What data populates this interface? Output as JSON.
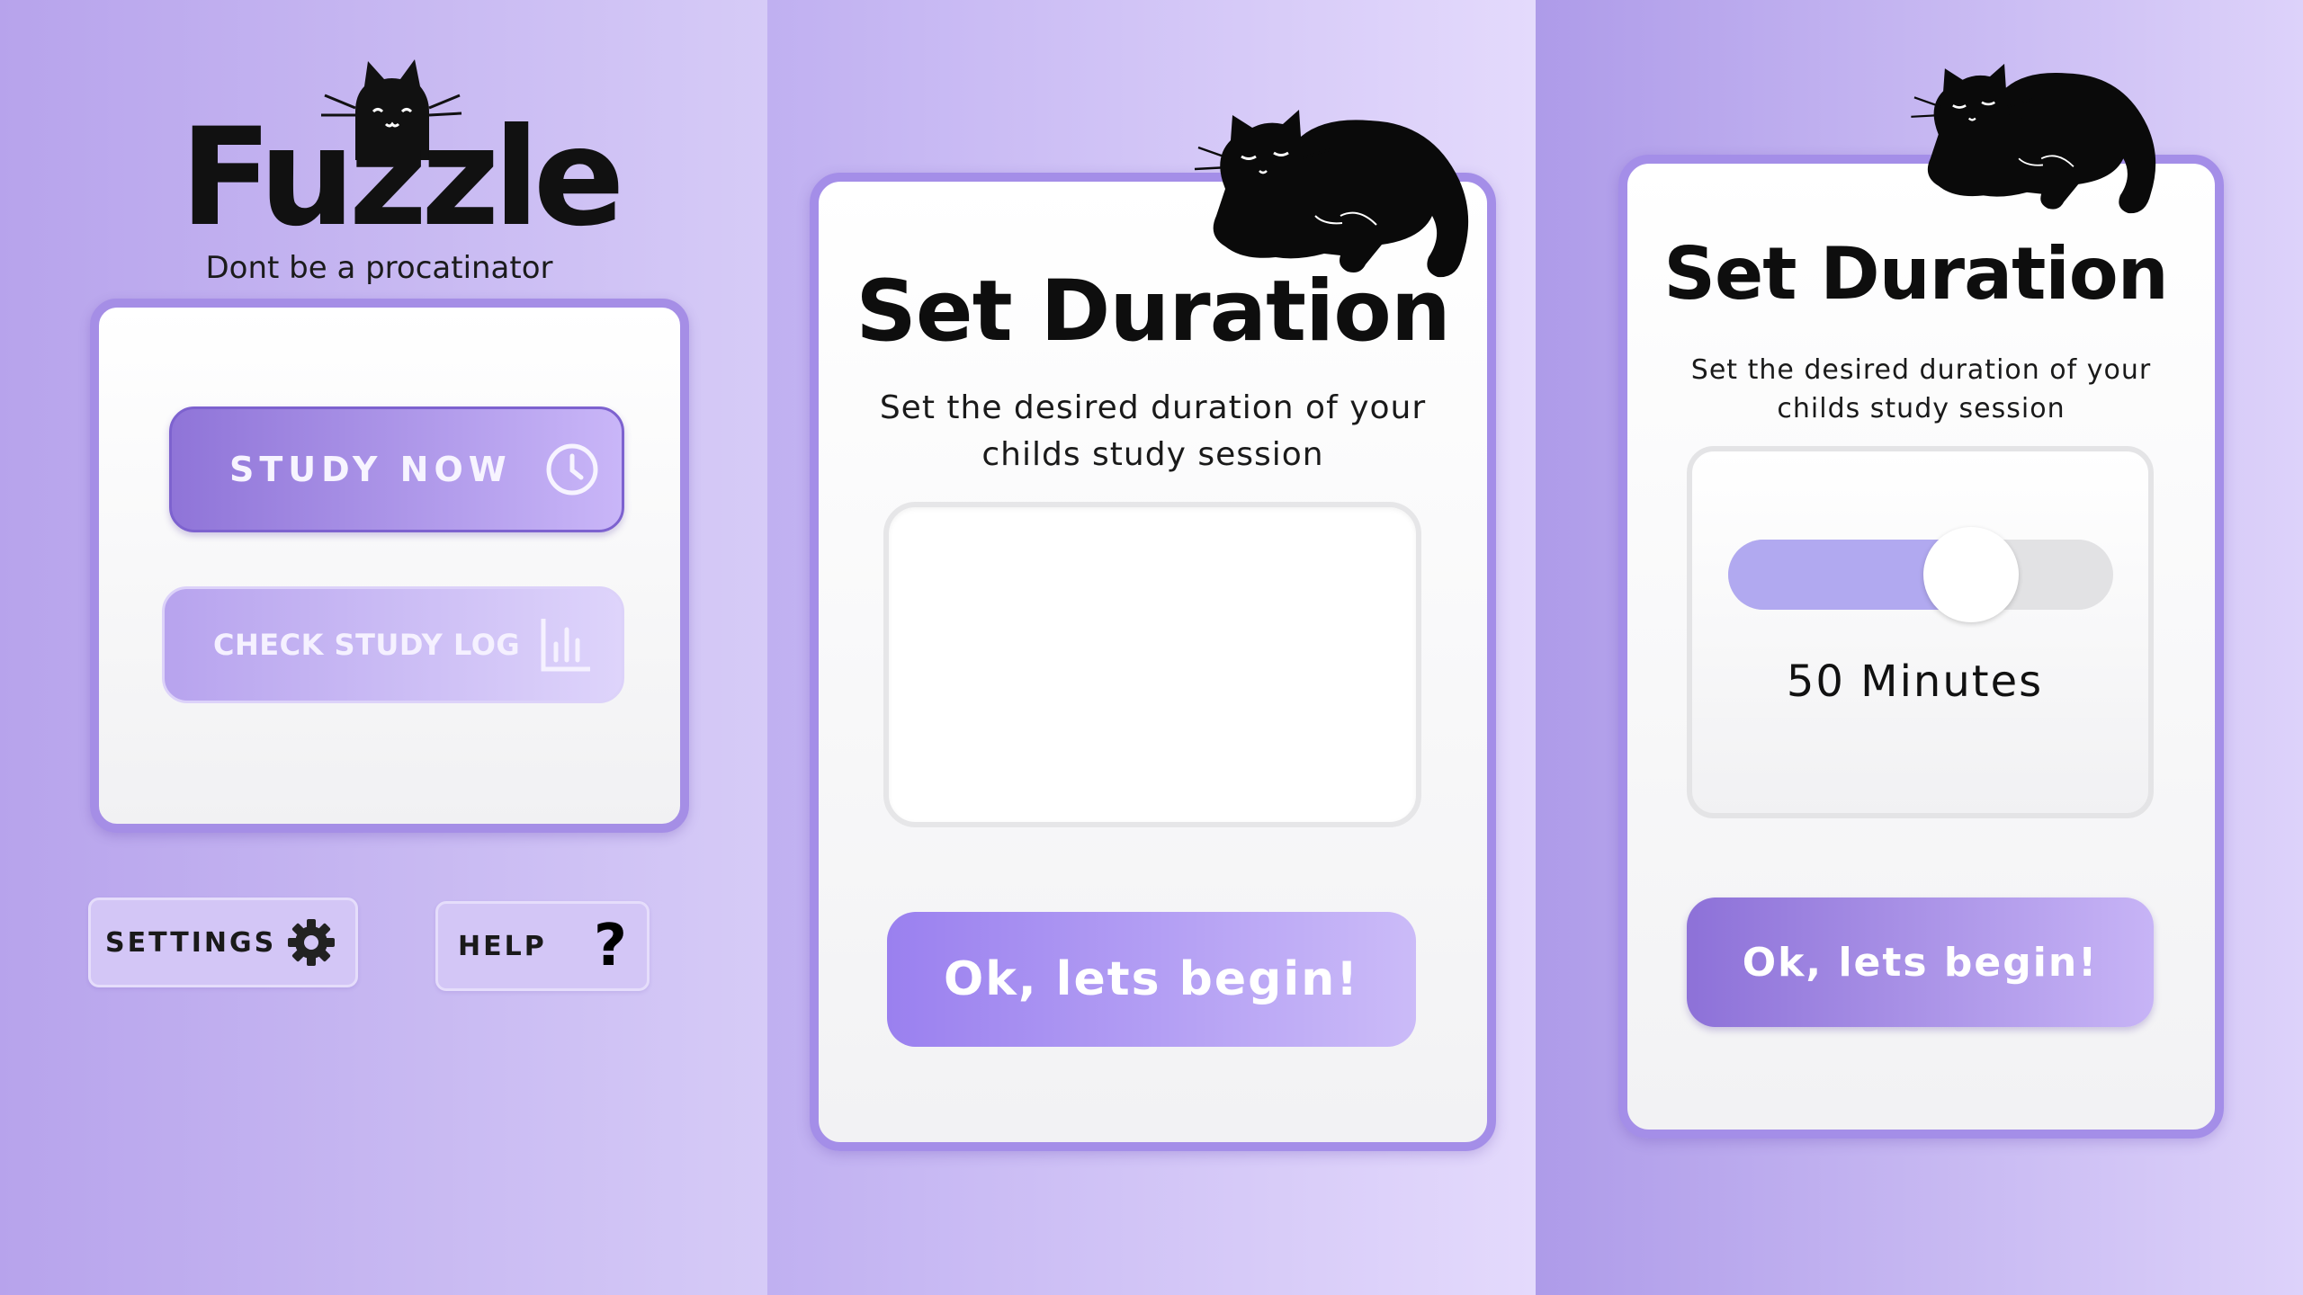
{
  "home": {
    "logo_title": "Fuzzle",
    "tagline": "Dont be a procatinator",
    "study_now_label": "STUDY NOW",
    "check_log_label": "CHECK STUDY LOG",
    "settings_label": "SETTINGS",
    "help_label": "HELP",
    "help_symbol": "?"
  },
  "duration_empty": {
    "title": "Set Duration",
    "subtitle": "Set the desired duration of your childs study session",
    "begin_label": "Ok, lets begin!"
  },
  "duration_slider": {
    "title": "Set Duration",
    "subtitle": "Set the desired duration of your childs study session",
    "slider_fraction": 0.63,
    "value_text": "50 Minutes",
    "begin_label": "Ok, lets begin!"
  },
  "colors": {
    "accent": "#a48ee8",
    "button_gradient_start": "#8f74d8",
    "button_gradient_end": "#c9b6f8",
    "slider_fill": "#b1a9f0"
  },
  "icons": [
    "cat-logo-icon",
    "clock-icon",
    "bar-chart-icon",
    "gear-icon",
    "sleeping-cat-icon"
  ]
}
